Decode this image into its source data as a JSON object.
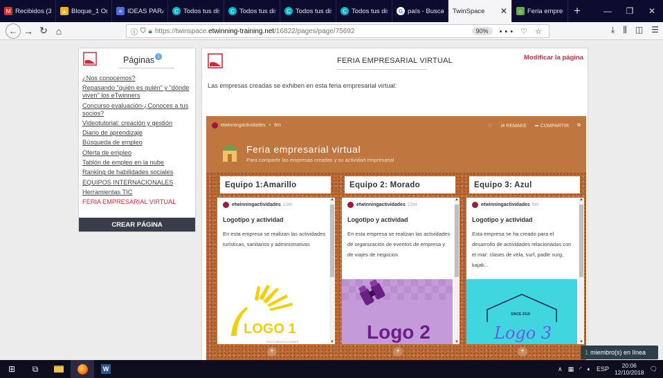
{
  "browser": {
    "tabs": [
      {
        "label": "Recibidos (30",
        "icon": "gmail-icon",
        "color": "#d93025"
      },
      {
        "label": "Bloque_1 Org",
        "icon": "drive-icon",
        "color": "#f4b400"
      },
      {
        "label": "IDEAS PARA A",
        "icon": "forms-icon",
        "color": "#4a6cd4"
      },
      {
        "label": "Todos tus dis",
        "icon": "canva-icon",
        "color": "#00b5c8"
      },
      {
        "label": "Todos tus dis",
        "icon": "canva-icon",
        "color": "#00b5c8"
      },
      {
        "label": "Todos tus dis",
        "icon": "canva-icon",
        "color": "#00b5c8"
      },
      {
        "label": "Todos tus dis",
        "icon": "canva-icon",
        "color": "#00b5c8"
      },
      {
        "label": "país - Buscar",
        "icon": "google-icon",
        "color": "#ffffff"
      }
    ],
    "active_tab": "TwinSpace",
    "last_tab": {
      "label": "Feria empresa",
      "icon": "house-icon",
      "color": "#6aa84f"
    },
    "url": {
      "protocol": "https://twinspace.",
      "host": "etwinning-training.net",
      "path": "/16822/pages/page/75692"
    },
    "zoom": "90%"
  },
  "sidebar": {
    "title": "Páginas",
    "items": [
      "¿Nos conocemos?",
      "Repasando \"quién es quién\" y \"dónde viven\" los eTwinners",
      "Concurso evaluación-¿Conoces a tus socios?",
      "Videotutorial: creación y gestión",
      "Diario de aprendizaje",
      "Búsqueda de empleo",
      "Oferta de empleo",
      "Tablón de empleo en la nube",
      "Ranking de habilidades sociales",
      "EQUIPOS INTERNACIONALES",
      "Herramientas TIC",
      "FERIA EMPRESARIAL VIRTUAL"
    ],
    "active_index": 11,
    "create_button": "CREAR PÁGINA"
  },
  "main": {
    "title": "FERIA EMPRESARIAL VIRTUAL",
    "modify_link": "Modificar la página",
    "intro": "Las empresas creadas se exhiben en esta feria empresarial virtual:"
  },
  "padlet": {
    "author": "etwinningactividades",
    "time": "6m",
    "remake": "REMAKE",
    "share": "COMPARTIR",
    "title": "Feria empresarial virtual",
    "subtitle": "Para compartir las empresas creadas y su actividad empresarial",
    "columns": [
      {
        "header": "Equipo 1:Amarillo",
        "author": "etwinningactividades",
        "ago": "10m",
        "card_title": "Logotipo y actividad",
        "card_body": "En esta empresa se realizan las actividades turísticas, sanitarios y administrativas",
        "logo_text": "LOGO 1",
        "logo_sub": "TELECOMUNICACIONES"
      },
      {
        "header": "Equipo 2: Morado",
        "author": "etwinningactividades",
        "ago": "10m",
        "card_title": "Logotipo y actividad",
        "card_body": "En esta empresa se realizan las actividades de organización de eventos de empresa y de viajes de negocios",
        "logo_text": "Logo 2"
      },
      {
        "header": "Equipo 3: Azul",
        "author": "etwinningactividades",
        "ago": "9m",
        "card_title": "Logotipo y actividad",
        "card_body": "Esta empresa se ha creado para el desarrollo de actividades relacionadas con el mar: clases de vela, surf, padle surg, kajak...",
        "logo_text": "Logo 3",
        "logo_sub": "SINCE 2018"
      }
    ]
  },
  "toast": {
    "count": "1",
    "text": "miembro(s) en línea"
  },
  "taskbar": {
    "lang": "ESP",
    "time": "20:06",
    "date": "12/10/2018"
  },
  "colors": {
    "accent": "#e2243a",
    "padlet_bg": "#c0773f",
    "dark": "#3a3d4a"
  }
}
